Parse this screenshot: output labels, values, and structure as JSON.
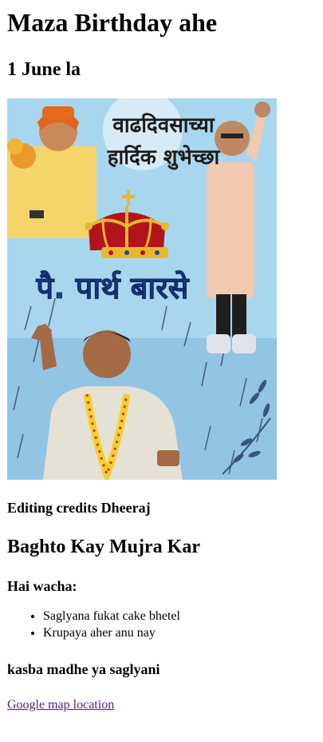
{
  "header": {
    "title": "Maza Birthday ahe",
    "date": "1 June la"
  },
  "poster": {
    "heading_line1": "वाढदिवसाच्या",
    "heading_line2": "हार्दिक शुभेच्छा",
    "name": "पै. पार्थ बारसे",
    "colors": {
      "sky": "#a8d6ee",
      "name_text": "#1c3f8f",
      "crown_gold": "#e8b82a",
      "crown_red": "#b2141a"
    }
  },
  "credits": "Editing credits Dheeraj",
  "subheading": "Baghto Kay Mujra Kar",
  "invite_label": "Hai wacha:",
  "notes": [
    "Saglyana fukat cake bhetel",
    "Krupaya aher anu nay"
  ],
  "location_label": "kasba madhe ya saglyani",
  "map_link": {
    "text": "Google map location"
  }
}
